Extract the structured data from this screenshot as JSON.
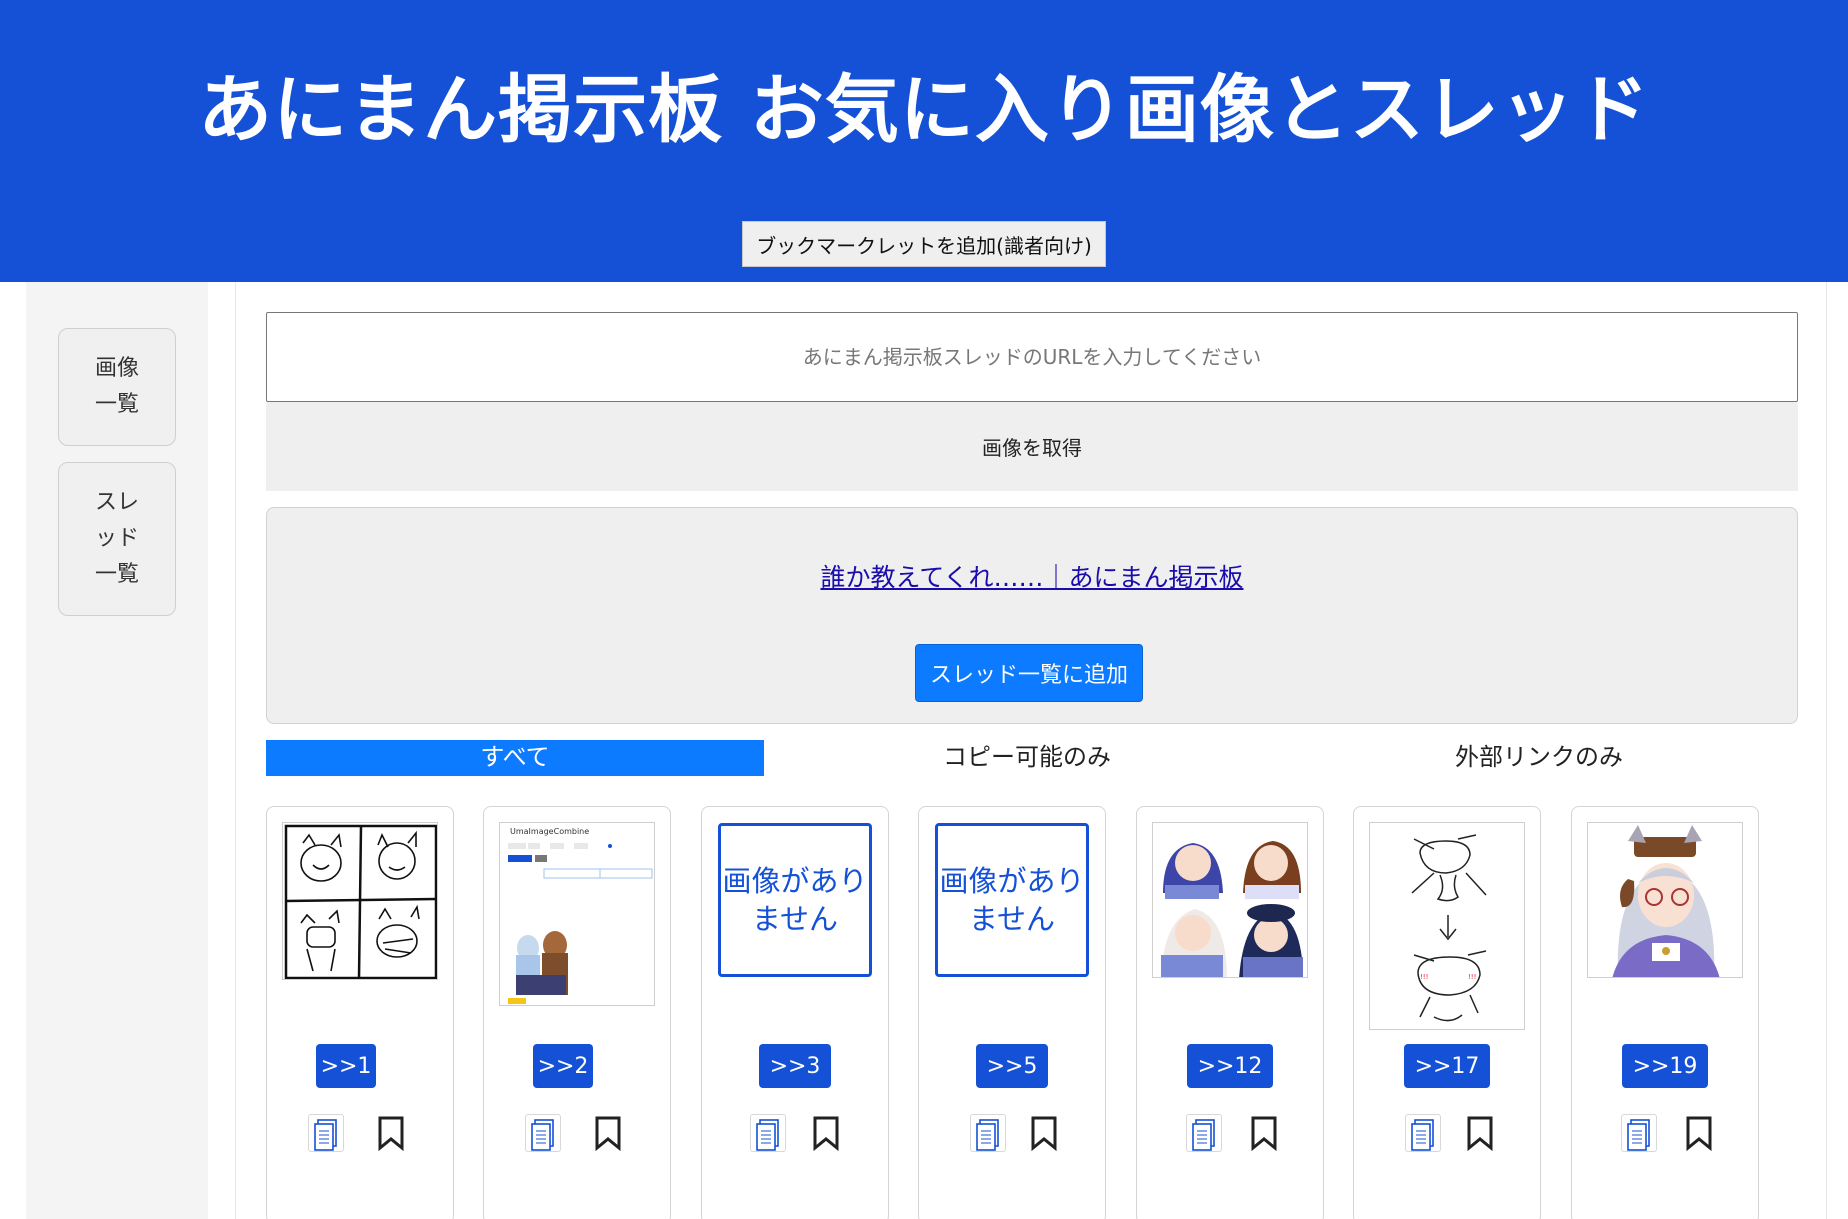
{
  "header": {
    "title": "あにまん掲示板 お気に入り画像とスレッド",
    "bookmarklet_label": "ブックマークレットを追加(識者向け)"
  },
  "sidebar": {
    "items": [
      {
        "label": "画像一覧"
      },
      {
        "label": "スレッド一覧"
      }
    ]
  },
  "main": {
    "url_placeholder": "あにまん掲示板スレッドのURLを入力してください",
    "fetch_label": "画像を取得",
    "thread_link": "誰か教えてくれ……｜あにまん掲示板",
    "add_thread_label": "スレッド一覧に追加",
    "tabs": [
      {
        "label": "すべて",
        "active": true
      },
      {
        "label": "コピー可能のみ",
        "active": false
      },
      {
        "label": "外部リンクのみ",
        "active": false
      }
    ],
    "no_image_text": "画像がありません",
    "cards": [
      {
        "res": ">>1",
        "image": "rough-sketch-four-panel"
      },
      {
        "res": ">>2",
        "image": "uma-image-combine-screenshot",
        "caption": "UmaImageCombine"
      },
      {
        "res": ">>3",
        "image": "none"
      },
      {
        "res": ">>5",
        "image": "none"
      },
      {
        "res": ">>12",
        "image": "anime-girls-four-panel"
      },
      {
        "res": ">>17",
        "image": "rough-sketch-two-figures"
      },
      {
        "res": ">>19",
        "image": "anime-girl-glasses"
      }
    ]
  },
  "colors": {
    "header_blue": "#1451d6",
    "accent_blue": "#0d7bff",
    "link": "#1a0dab"
  }
}
